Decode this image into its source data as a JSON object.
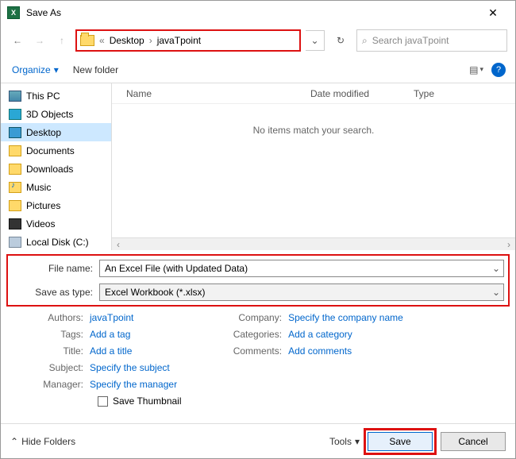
{
  "titlebar": {
    "title": "Save As"
  },
  "breadcrumb": {
    "prefix": "«",
    "parts": [
      "Desktop",
      "javaTpoint"
    ]
  },
  "search": {
    "placeholder": "Search javaTpoint"
  },
  "toolbar": {
    "organize": "Organize",
    "new_folder": "New folder"
  },
  "tree": [
    {
      "label": "This PC",
      "icon": "pc"
    },
    {
      "label": "3D Objects",
      "icon": "3d"
    },
    {
      "label": "Desktop",
      "icon": "desk",
      "selected": true
    },
    {
      "label": "Documents",
      "icon": "doc"
    },
    {
      "label": "Downloads",
      "icon": "dl"
    },
    {
      "label": "Music",
      "icon": "mus"
    },
    {
      "label": "Pictures",
      "icon": "pic"
    },
    {
      "label": "Videos",
      "icon": "vid"
    },
    {
      "label": "Local Disk (C:)",
      "icon": "disk"
    }
  ],
  "columns": {
    "name": "Name",
    "date": "Date modified",
    "type": "Type"
  },
  "empty_text": "No items match your search.",
  "fields": {
    "filename_label": "File name:",
    "filename_value": "An Excel File (with Updated Data)",
    "savetype_label": "Save as type:",
    "savetype_value": "Excel Workbook (*.xlsx)"
  },
  "meta_left": {
    "authors_label": "Authors:",
    "authors_value": "javaTpoint",
    "tags_label": "Tags:",
    "tags_value": "Add a tag",
    "title_label": "Title:",
    "title_value": "Add a title",
    "subject_label": "Subject:",
    "subject_value": "Specify the subject",
    "manager_label": "Manager:",
    "manager_value": "Specify the manager"
  },
  "meta_right": {
    "company_label": "Company:",
    "company_value": "Specify the company name",
    "categories_label": "Categories:",
    "categories_value": "Add a category",
    "comments_label": "Comments:",
    "comments_value": "Add comments"
  },
  "thumbnail_label": "Save Thumbnail",
  "footer": {
    "hide_folders": "Hide Folders",
    "tools": "Tools",
    "save": "Save",
    "cancel": "Cancel"
  }
}
